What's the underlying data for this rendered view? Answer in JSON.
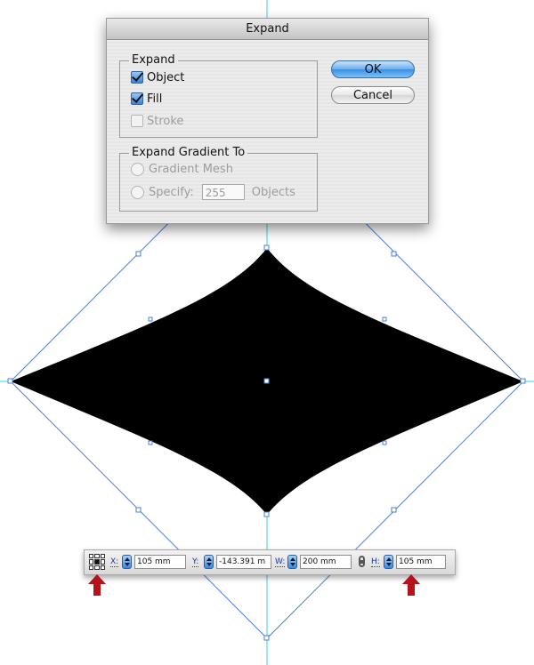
{
  "dialog": {
    "title": "Expand",
    "expand_group": {
      "legend": "Expand",
      "object": {
        "label": "Object",
        "checked": true
      },
      "fill": {
        "label": "Fill",
        "checked": true
      },
      "stroke": {
        "label": "Stroke",
        "checked": false,
        "disabled": true
      }
    },
    "gradient_group": {
      "legend": "Expand Gradient To",
      "gradient_mesh": {
        "label": "Gradient Mesh"
      },
      "specify": {
        "label": "Specify:",
        "value": "255",
        "suffix": "Objects"
      }
    },
    "ok_label": "OK",
    "cancel_label": "Cancel"
  },
  "control_bar": {
    "x": {
      "label": "X:",
      "value": "105 mm"
    },
    "y": {
      "label": "Y:",
      "value": "-143.391 m"
    },
    "w": {
      "label": "W:",
      "value": "200 mm"
    },
    "h": {
      "label": "H:",
      "value": "105 mm"
    }
  },
  "colors": {
    "guide": "#33d6ee",
    "bounding_box": "#4a7fdc",
    "shape_fill": "#000000",
    "arrow": "#b5121b"
  },
  "icons": [
    "reference-point-icon",
    "spinner-icon",
    "link-proportions-icon",
    "up-arrow-icon",
    "checkmark-icon"
  ]
}
